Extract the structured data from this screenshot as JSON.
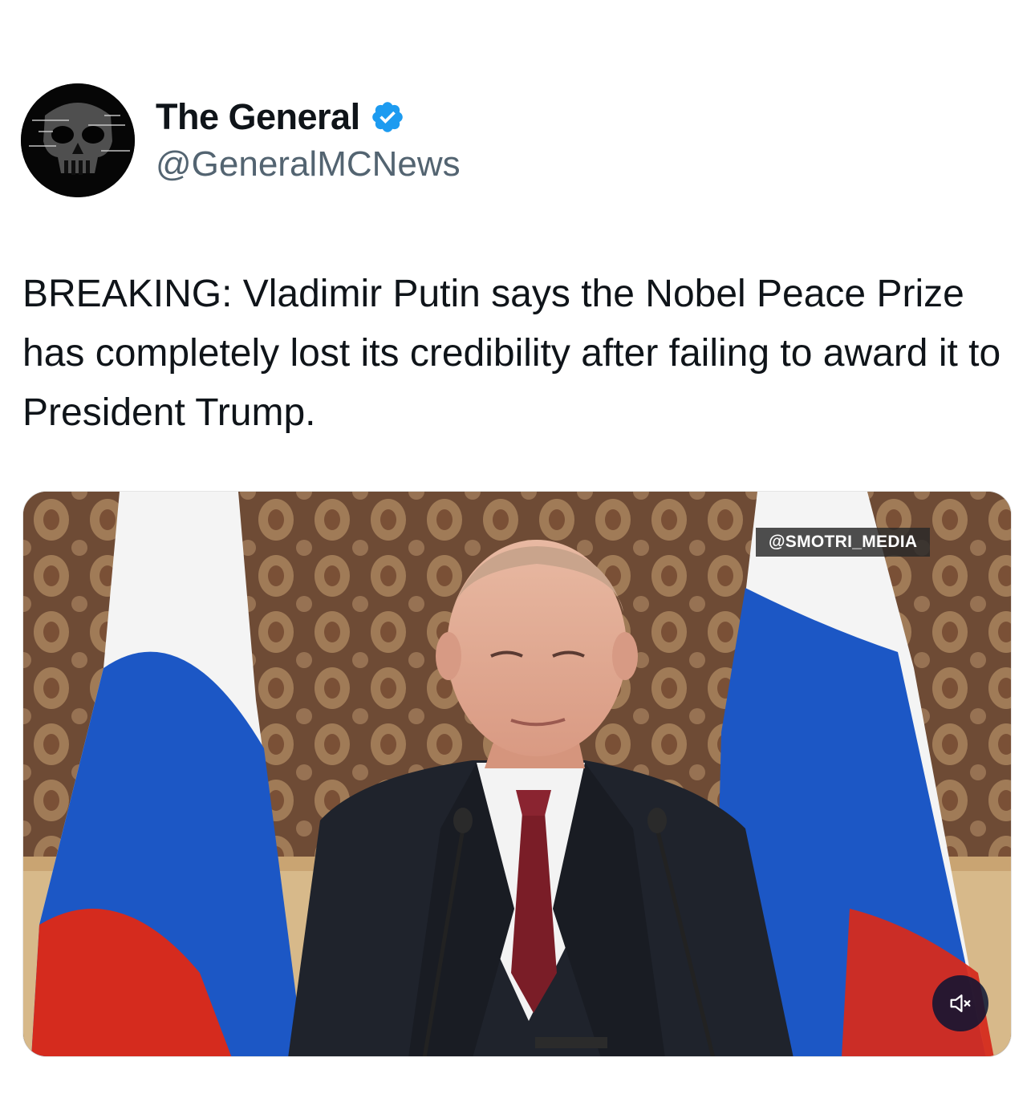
{
  "author": {
    "display_name": "The General",
    "handle": "@GeneralMCNews",
    "verified": true,
    "avatar_icon": "skull-avatar-icon"
  },
  "tweet": {
    "text": "BREAKING: Vladimir Putin says the Nobel Peace Prize has completely lost its credibility after failing to award it to President Trump."
  },
  "media": {
    "type": "video",
    "watermark": "@SMOTRI_MEDIA",
    "mute_icon": "speaker-muted-icon"
  },
  "colors": {
    "verified_badge": "#1d9bf0",
    "text_primary": "#0f1419",
    "text_secondary": "#536471",
    "flag_white": "#f4f4f4",
    "flag_blue": "#1c57c5",
    "flag_red": "#d52b1e"
  }
}
